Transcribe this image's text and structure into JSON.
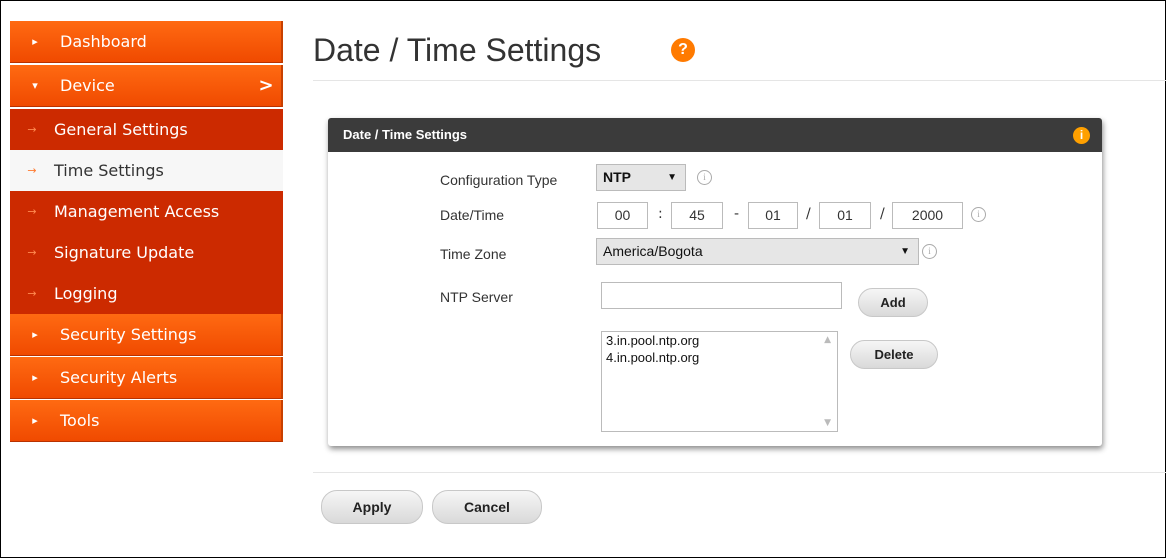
{
  "sidebar": {
    "items": [
      {
        "label": "Dashboard",
        "marker": "▸"
      },
      {
        "label": "Device",
        "marker": "▾",
        "chevron": ">"
      },
      {
        "label": "General Settings",
        "marker": "→"
      },
      {
        "label": "Time Settings",
        "marker": "→"
      },
      {
        "label": "Management Access",
        "marker": "→"
      },
      {
        "label": "Signature Update",
        "marker": "→"
      },
      {
        "label": "Logging",
        "marker": "→"
      },
      {
        "label": "Security Settings",
        "marker": "▸"
      },
      {
        "label": "Security Alerts",
        "marker": "▸"
      },
      {
        "label": "Tools",
        "marker": "▸"
      }
    ],
    "active_label": "Time Settings"
  },
  "page": {
    "title": "Date / Time Settings",
    "help_icon": "help-icon",
    "help_glyph": "?"
  },
  "panel": {
    "title": "Date / Time Settings",
    "info_glyph": "i",
    "config_type": {
      "label": "Configuration Type",
      "value": "NTP"
    },
    "datetime": {
      "label": "Date/Time",
      "hour": "00",
      "minute": "45",
      "month": "01",
      "day": "01",
      "year": "2000",
      "sep_colon": ":",
      "sep_dash": "-",
      "sep_slash": "/"
    },
    "timezone": {
      "label": "Time Zone",
      "value": "America/Bogota"
    },
    "ntp_server": {
      "label": "NTP Server",
      "value": "",
      "add_label": "Add"
    },
    "servers": [
      "3.in.pool.ntp.org",
      "4.in.pool.ntp.org"
    ],
    "delete_label": "Delete",
    "info_small": "i"
  },
  "footer": {
    "apply_label": "Apply",
    "cancel_label": "Cancel"
  },
  "colors": {
    "accent": "#f05a00",
    "submenu": "#cc2a00",
    "panel_header": "#3b3b3b"
  }
}
